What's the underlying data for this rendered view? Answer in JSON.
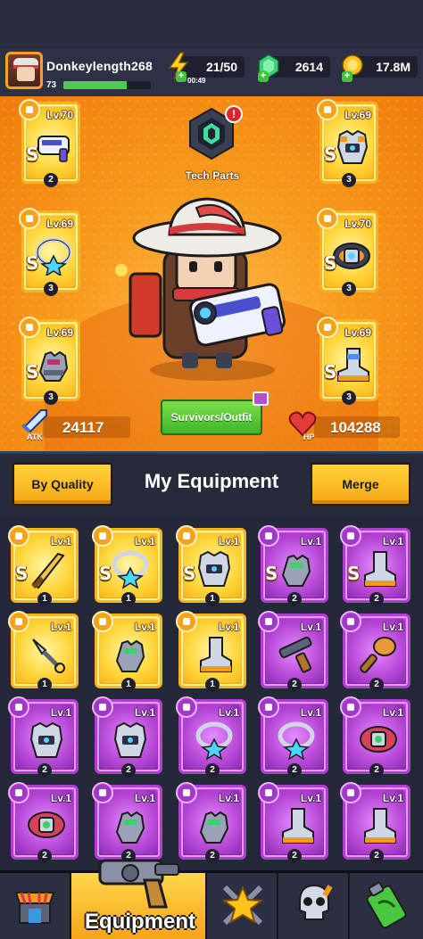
{
  "player": {
    "name": "Donkeylength268",
    "level": "73",
    "xp_progress": 0.72
  },
  "resources": {
    "energy": "21/50",
    "energy_timer": "00:49",
    "gems": "2614",
    "coins": "17.8M"
  },
  "hero": {
    "tech_parts_label": "Tech Parts",
    "tech_alert": "!",
    "outfit_button": "Survivors/Outfit",
    "atk_label": "ATK",
    "atk_value": "24117",
    "hp_label": "HP",
    "hp_value": "104288",
    "slots": [
      {
        "name": "weapon",
        "level": "Lv.70",
        "grade": "S",
        "stars": "2",
        "rarity": "gold",
        "icon": "gun-icon"
      },
      {
        "name": "armor",
        "level": "Lv.69",
        "grade": "S",
        "stars": "3",
        "rarity": "gold",
        "icon": "armor-icon"
      },
      {
        "name": "necklace",
        "level": "Lv.69",
        "grade": "S",
        "stars": "3",
        "rarity": "gold",
        "icon": "necklace-icon"
      },
      {
        "name": "belt",
        "level": "Lv.70",
        "grade": "S",
        "stars": "3",
        "rarity": "gold",
        "icon": "belt-icon"
      },
      {
        "name": "gloves",
        "level": "Lv.69",
        "grade": "S",
        "stars": "3",
        "rarity": "gold",
        "icon": "gloves-icon"
      },
      {
        "name": "boots",
        "level": "Lv.69",
        "grade": "S",
        "stars": "3",
        "rarity": "gold",
        "icon": "boots-icon"
      }
    ]
  },
  "equipment_header": {
    "sort_button": "By Quality",
    "title": "My Equipment",
    "merge_button": "Merge"
  },
  "inventory": [
    {
      "level": "Lv.1",
      "grade": "S",
      "stars": "1",
      "rarity": "gold",
      "icon": "sword-icon"
    },
    {
      "level": "Lv.1",
      "grade": "S",
      "stars": "1",
      "rarity": "gold",
      "icon": "necklace-icon"
    },
    {
      "level": "Lv.1",
      "grade": "S",
      "stars": "1",
      "rarity": "gold",
      "icon": "armor-icon"
    },
    {
      "level": "Lv.1",
      "grade": "S",
      "stars": "2",
      "rarity": "purple",
      "icon": "gloves-icon"
    },
    {
      "level": "Lv.1",
      "grade": "S",
      "stars": "2",
      "rarity": "purple",
      "icon": "boots-icon"
    },
    {
      "level": "Lv.1",
      "grade": "",
      "stars": "1",
      "rarity": "gold",
      "icon": "kunai-icon"
    },
    {
      "level": "Lv.1",
      "grade": "",
      "stars": "1",
      "rarity": "gold",
      "icon": "gloves-icon"
    },
    {
      "level": "Lv.1",
      "grade": "",
      "stars": "1",
      "rarity": "gold",
      "icon": "boots-icon"
    },
    {
      "level": "Lv.1",
      "grade": "",
      "stars": "2",
      "rarity": "purple",
      "icon": "shotgun-icon"
    },
    {
      "level": "Lv.1",
      "grade": "",
      "stars": "2",
      "rarity": "purple",
      "icon": "bat-icon"
    },
    {
      "level": "Lv.1",
      "grade": "",
      "stars": "2",
      "rarity": "purple",
      "icon": "armor-icon"
    },
    {
      "level": "Lv.1",
      "grade": "",
      "stars": "2",
      "rarity": "purple",
      "icon": "armor-icon"
    },
    {
      "level": "Lv.1",
      "grade": "",
      "stars": "2",
      "rarity": "purple",
      "icon": "necklace-icon"
    },
    {
      "level": "Lv.1",
      "grade": "",
      "stars": "2",
      "rarity": "purple",
      "icon": "necklace-icon"
    },
    {
      "level": "Lv.1",
      "grade": "",
      "stars": "2",
      "rarity": "purple",
      "icon": "belt-icon"
    },
    {
      "level": "Lv.1",
      "grade": "",
      "stars": "2",
      "rarity": "purple",
      "icon": "belt-icon"
    },
    {
      "level": "Lv.1",
      "grade": "",
      "stars": "2",
      "rarity": "purple",
      "icon": "gloves-icon"
    },
    {
      "level": "Lv.1",
      "grade": "",
      "stars": "2",
      "rarity": "purple",
      "icon": "gloves-icon"
    },
    {
      "level": "Lv.1",
      "grade": "",
      "stars": "2",
      "rarity": "purple",
      "icon": "boots-icon"
    },
    {
      "level": "Lv.1",
      "grade": "",
      "stars": "2",
      "rarity": "purple",
      "icon": "boots-icon"
    }
  ],
  "nav": {
    "active_label": "Equipment",
    "tabs": [
      "shop-icon",
      "equipment-icon",
      "star-icon",
      "skull-icon",
      "battery-icon"
    ]
  },
  "colors": {
    "gold": "#f7b321",
    "purple": "#b13ed3",
    "green_button": "#3fb52b",
    "hero_bg": "#f89a1c"
  }
}
